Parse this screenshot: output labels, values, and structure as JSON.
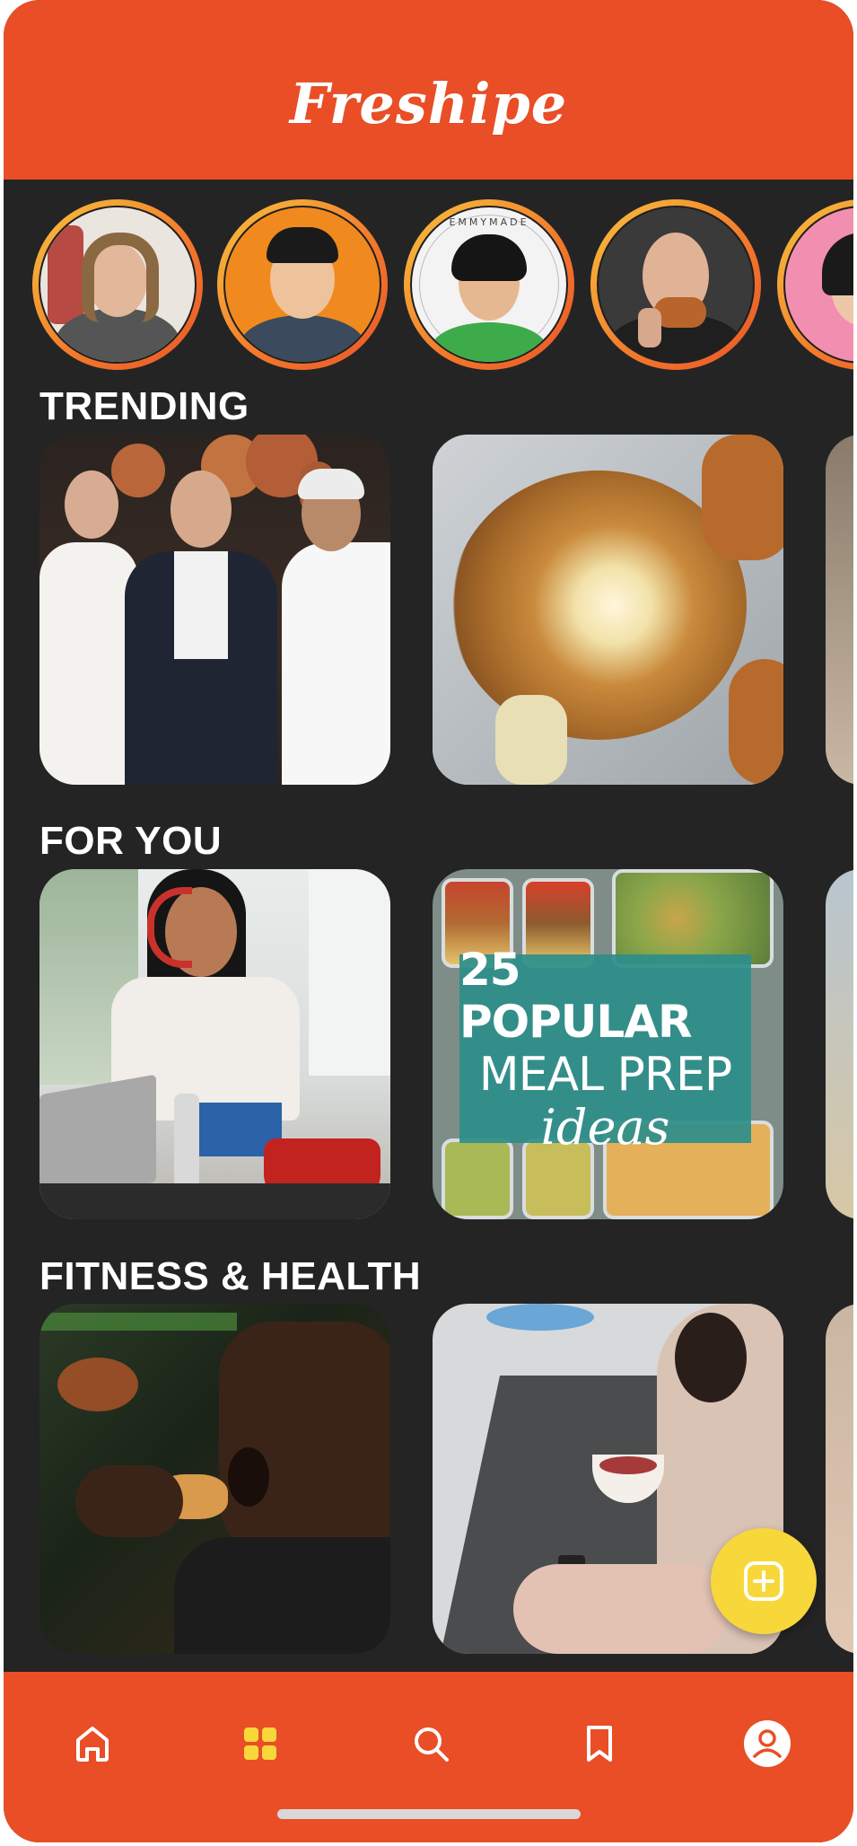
{
  "app": {
    "name": "Freshipe"
  },
  "stories": [
    {
      "name": "chef-with-meat",
      "bg": "#efe9e4",
      "skin": "#e2b79a",
      "hair": "#7a5a3a",
      "shirt": "#4a4a4a"
    },
    {
      "name": "chef-orange",
      "bg": "#f08a1f",
      "skin": "#eec39c",
      "hair": "#1a1a1a",
      "shirt": "#3a4a5a"
    },
    {
      "name": "emmymade",
      "bg": "#f2f2f2",
      "skin": "#e6b892",
      "hair": "#151515",
      "shirt": "#3dab4a",
      "badge": "EMMYMADE"
    },
    {
      "name": "chef-bald",
      "bg": "#3a3a3a",
      "skin": "#e0b397",
      "hair": "#2a2a2a",
      "shirt": "#1f1f1f"
    },
    {
      "name": "chef-pink",
      "bg": "#f28fb0",
      "skin": "#eec6a8",
      "hair": "#1a1a1a",
      "shirt": "#ffffff"
    }
  ],
  "sections": {
    "trending": {
      "title": "TRENDING"
    },
    "for_you": {
      "title": "FOR YOU",
      "meal_prep": {
        "line1": "25 POPULAR",
        "line2": "MEAL PREP",
        "line3": "ideas"
      }
    },
    "fitness": {
      "title": "FITNESS & HEALTH"
    }
  },
  "tabs": [
    {
      "name": "home",
      "active": false
    },
    {
      "name": "grid",
      "active": true
    },
    {
      "name": "search",
      "active": false
    },
    {
      "name": "bookmark",
      "active": false
    },
    {
      "name": "profile",
      "active": false
    }
  ],
  "colors": {
    "brand": "#e94e26",
    "accent": "#f8d73a",
    "background": "#242424"
  }
}
